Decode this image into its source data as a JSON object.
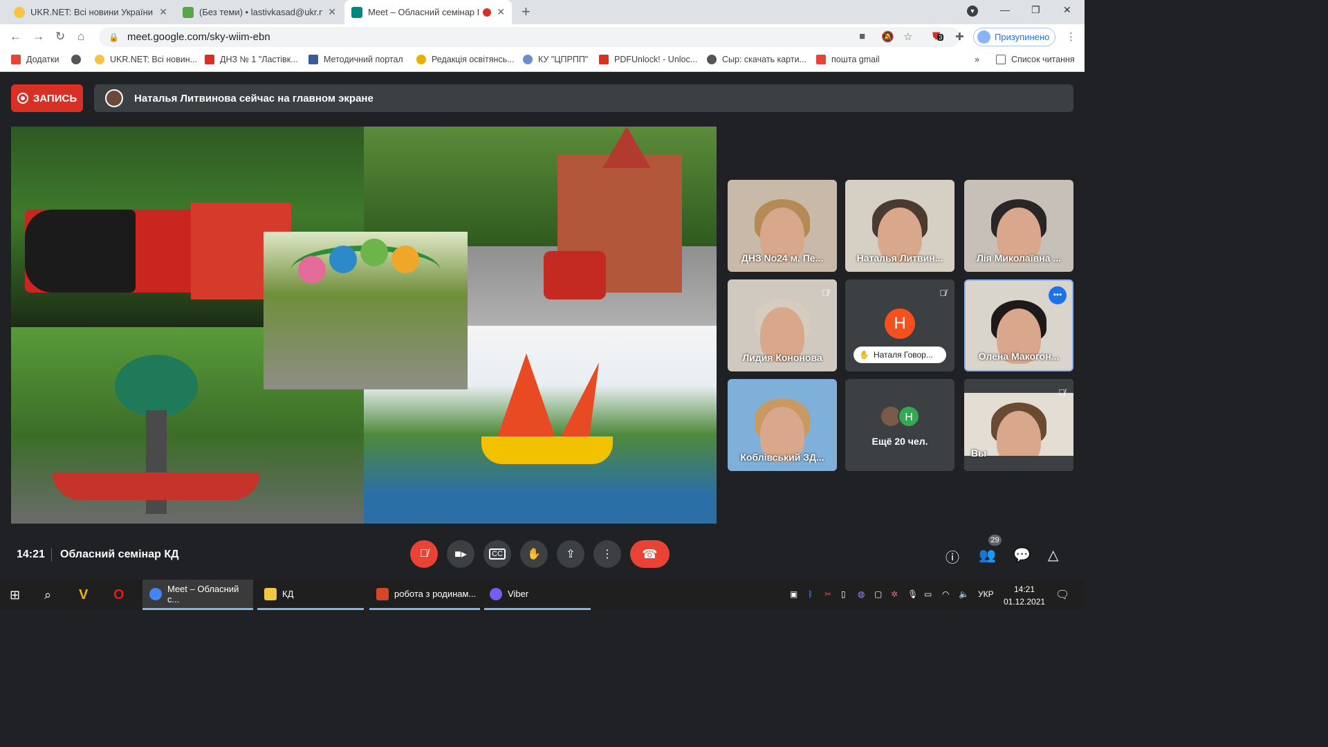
{
  "browser": {
    "tabs": [
      {
        "title": "UKR.NET: Всі новини України, о",
        "color": "#f6c342"
      },
      {
        "title": "(Без теми) • lastivkasad@ukr.net",
        "color": "#5aa34a"
      },
      {
        "title": "Meet – Обласний семінар К",
        "color": "#00897b"
      }
    ],
    "url": "meet.google.com/sky-wiim-ebn",
    "profile_label": "Призупинено",
    "extension_badge": "3",
    "bookmarks": [
      {
        "label": "Додатки",
        "color": "#ea4335"
      },
      {
        "label": "",
        "color": "#555555"
      },
      {
        "label": "UKR.NET: Всі новин...",
        "color": "#f6c342"
      },
      {
        "label": "ДНЗ № 1 \"Ластівк...",
        "color": "#d93025"
      },
      {
        "label": "Методичний портал",
        "color": "#3c5a99"
      },
      {
        "label": "Редакція освітянсь...",
        "color": "#e8b000"
      },
      {
        "label": "КУ \"ЦПРПП\"",
        "color": "#6d8ccf"
      },
      {
        "label": "PDFUnlock! - Unloc...",
        "color": "#d93025"
      },
      {
        "label": "Сыр: скачать карти...",
        "color": "#555555"
      },
      {
        "label": "пошта gmail",
        "color": "#ea4335"
      }
    ],
    "reading_list": "Список читання",
    "more_bookmarks": "»"
  },
  "meet": {
    "record_label": "ЗАПИСЬ",
    "banner_text": "Наталья Литвинова сейчас на главном экране",
    "participants": [
      {
        "name": "ДНЗ No24 м. Пе...",
        "muted": false,
        "bg": "#c9b9a8",
        "hair": "#b58a55"
      },
      {
        "name": "Наталья Литвин...",
        "muted": false,
        "bg": "#d6cfc4",
        "hair": "#4a3a30"
      },
      {
        "name": "Лія Миколаївна ...",
        "muted": false,
        "bg": "#c7c0b8",
        "hair": "#2a2526"
      },
      {
        "name": "Лидия Кононова",
        "muted": true,
        "bg": "#cfc9bf",
        "hair": "#d7ccc0"
      },
      {
        "name": "Наталя Говор...",
        "muted": true,
        "bg": "#3c4043",
        "avatar_letter": "Н",
        "hand_raised": true
      },
      {
        "name": "Олена Макогон...",
        "muted": false,
        "bg": "#d9d4cc",
        "hair": "#1e1a1a",
        "active": true
      },
      {
        "name": "Коблівський ЗД...",
        "muted": false,
        "bg": "#7fb0d9",
        "hair": "#c89a62"
      },
      {
        "name": "Ещё 20 чел.",
        "muted": false,
        "bg": "#3c4043",
        "more": true
      },
      {
        "name": "Вы",
        "muted": true,
        "bg": "#e3ddd3",
        "hair": "#6a4a32"
      }
    ],
    "more_avatar_letter": "H",
    "clock": "14:21",
    "meeting_title": "Обласний семінар КД",
    "people_count": "29"
  },
  "taskbar": {
    "items": [
      {
        "label": "Meet – Обласний с...",
        "color": "#4285f4"
      },
      {
        "label": "КД",
        "color": "#f2c744"
      },
      {
        "label": "робота з родинам...",
        "color": "#d24726"
      },
      {
        "label": "Viber",
        "color": "#7360f2"
      }
    ],
    "lang": "УКР",
    "time": "14:21",
    "date": "01.12.2021"
  }
}
